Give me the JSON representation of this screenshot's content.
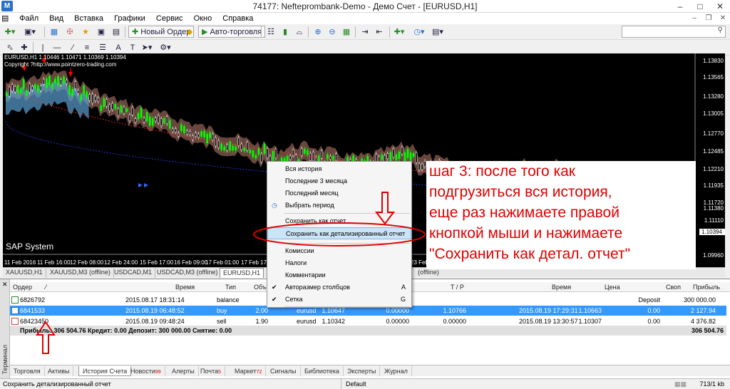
{
  "window": {
    "title": "74177: Nefteprombank-Demo - Демо Счет - [EURUSD,H1]"
  },
  "menu": [
    "Файл",
    "Вид",
    "Вставка",
    "Графики",
    "Сервис",
    "Окно",
    "Справка"
  ],
  "toolbar": {
    "new_order": "Новый Ордер",
    "autotrading": "Авто-торговля"
  },
  "chart": {
    "info": "EURUSD,H1  1.10446 1.10471 1.10369 1.10394",
    "copyright": "Copyright ?http://www.pointzero-trading.com",
    "indicator_label": "SAP System",
    "current_price": "1.10394",
    "price_ticks": [
      "1.13830",
      "1.13565",
      "1.13280",
      "1.13005",
      "1.12770",
      "1.12485",
      "1.12210",
      "1.11935",
      "1.11720",
      "1.11380",
      "1.11110",
      "1.10605",
      "1.10394",
      "1.09960"
    ],
    "time_ticks": [
      "11 Feb 2016",
      "11 Feb 16:00",
      "12 Feb 08:00",
      "12 Feb 24:00",
      "15 Feb 17:00",
      "16 Feb 09:00",
      "17 Feb 01:00",
      "17 Feb 17:00",
      "23 Feb"
    ],
    "colors": {
      "bull": "#00ff00",
      "bear": "#ffffff",
      "cloud_up": "#5aa0d0",
      "cloud_down": "#c08070",
      "signal": "#ff0000"
    }
  },
  "chart_tabs": [
    "XAUUSD,H1",
    "XAUUSD,M3 (offline)",
    "USDCAD,M1",
    "USDCAD,M3 (offline)",
    "EURUSD,H1",
    "(offline)"
  ],
  "terminal": {
    "side_label": "Терминал",
    "headers": {
      "order": "Ордер",
      "time": "Время",
      "type": "Тип",
      "volume": "Объем",
      "tp": "T / P",
      "close_time": "Время",
      "price": "Цена",
      "swap": "Своп",
      "profit": "Прибыль"
    },
    "rows": [
      {
        "order": "6826792",
        "time": "2015.08.17 18:31:14",
        "type": "balance",
        "volume": "",
        "symbol": "",
        "open_price": "",
        "sl": "",
        "tp": "",
        "close_time": "",
        "close_price": "",
        "swap": "Deposit",
        "profit": "300 000.00"
      },
      {
        "order": "6841533",
        "time": "2015.08.19 06:48:52",
        "type": "buy",
        "volume": "2.00",
        "symbol": "eurusd",
        "open_price": "1.10647",
        "sl": "0.00000",
        "tp": "1.10766",
        "close_time": "2015.08.19 17:29:31",
        "close_price": "1.10663",
        "swap": "0.00",
        "profit": "2 127.94"
      },
      {
        "order": "68423450",
        "time": "2015.08.19 09:48:24",
        "type": "sell",
        "volume": "1.90",
        "symbol": "eurusd",
        "open_price": "1.10342",
        "sl": "0.00000",
        "tp": "0.00000",
        "close_time": "2015.08.19 13:30:57",
        "close_price": "1.10307",
        "swap": "0.00",
        "profit": "4 376.82"
      }
    ],
    "summary": "Прибыль: 306 504.76  Кредит: 0.00  Депозит: 300 000.00  Снятие: 0.00",
    "summary_total": "306 504.76",
    "tabs": [
      {
        "label": "Торговля",
        "badge": ""
      },
      {
        "label": "Активы",
        "badge": ""
      },
      {
        "label": "История Счета",
        "badge": ""
      },
      {
        "label": "Новости",
        "badge": "99"
      },
      {
        "label": "Алерты",
        "badge": ""
      },
      {
        "label": "Почта",
        "badge": "5"
      },
      {
        "label": "Маркет",
        "badge": "72"
      },
      {
        "label": "Сигналы",
        "badge": ""
      },
      {
        "label": "Библиотека",
        "badge": ""
      },
      {
        "label": "Эксперты",
        "badge": ""
      },
      {
        "label": "Журнал",
        "badge": ""
      }
    ]
  },
  "context_menu": [
    {
      "label": "Вся история",
      "key": "",
      "checked": false
    },
    {
      "label": "Последние 3 месяца",
      "key": "",
      "checked": false
    },
    {
      "label": "Последний месяц",
      "key": "",
      "checked": false
    },
    {
      "label": "Выбрать период",
      "key": "",
      "checked": false
    },
    {
      "label": "Сохранить как отчет",
      "key": "",
      "checked": false
    },
    {
      "label": "Сохранить как детализированный отчет",
      "key": "",
      "checked": false
    },
    {
      "label": "Комиссии",
      "key": "",
      "checked": false
    },
    {
      "label": "Налоги",
      "key": "",
      "checked": false
    },
    {
      "label": "Комментарии",
      "key": "",
      "checked": false
    },
    {
      "label": "Авторазмер столбцов",
      "key": "A",
      "checked": true
    },
    {
      "label": "Сетка",
      "key": "G",
      "checked": true
    }
  ],
  "annotation": {
    "lines": [
      "шаг 3: после того как",
      "подгрузиться вся история,",
      "еще раз нажимаете правой",
      "кнопкой мыши и нажимаете",
      "\"Сохранить как детал. отчет\""
    ],
    "color": "#e00000"
  },
  "status": {
    "text": "Сохранить детализированный отчет",
    "profile": "Default",
    "traffic": "713/1 kb"
  }
}
